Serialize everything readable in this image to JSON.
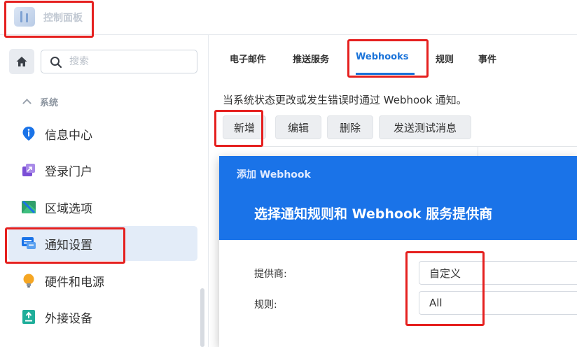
{
  "header": {
    "title": "控制面板"
  },
  "sidebar": {
    "search_placeholder": "搜索",
    "section": "系统",
    "items": [
      {
        "label": "信息中心"
      },
      {
        "label": "登录门户"
      },
      {
        "label": "区域选项"
      },
      {
        "label": "通知设置"
      },
      {
        "label": "硬件和电源"
      },
      {
        "label": "外接设备"
      }
    ]
  },
  "main": {
    "tabs": [
      {
        "label": "电子邮件"
      },
      {
        "label": "推送服务"
      },
      {
        "label": "Webhooks"
      },
      {
        "label": "规则"
      },
      {
        "label": "事件"
      }
    ],
    "description": "当系统状态更改或发生错误时通过 Webhook 通知。",
    "buttons": {
      "add": "新增",
      "edit": "编辑",
      "delete": "删除",
      "send_test": "发送测试消息"
    }
  },
  "dialog": {
    "title": "添加 Webhook",
    "heading": "选择通知规则和 Webhook 服务提供商",
    "provider_label": "提供商:",
    "provider_value": "自定义",
    "rule_label": "规则:",
    "rule_value": "All"
  },
  "colors": {
    "accent": "#1a73e8",
    "highlight": "#e5201f",
    "active_bg": "#e3ecf8"
  }
}
